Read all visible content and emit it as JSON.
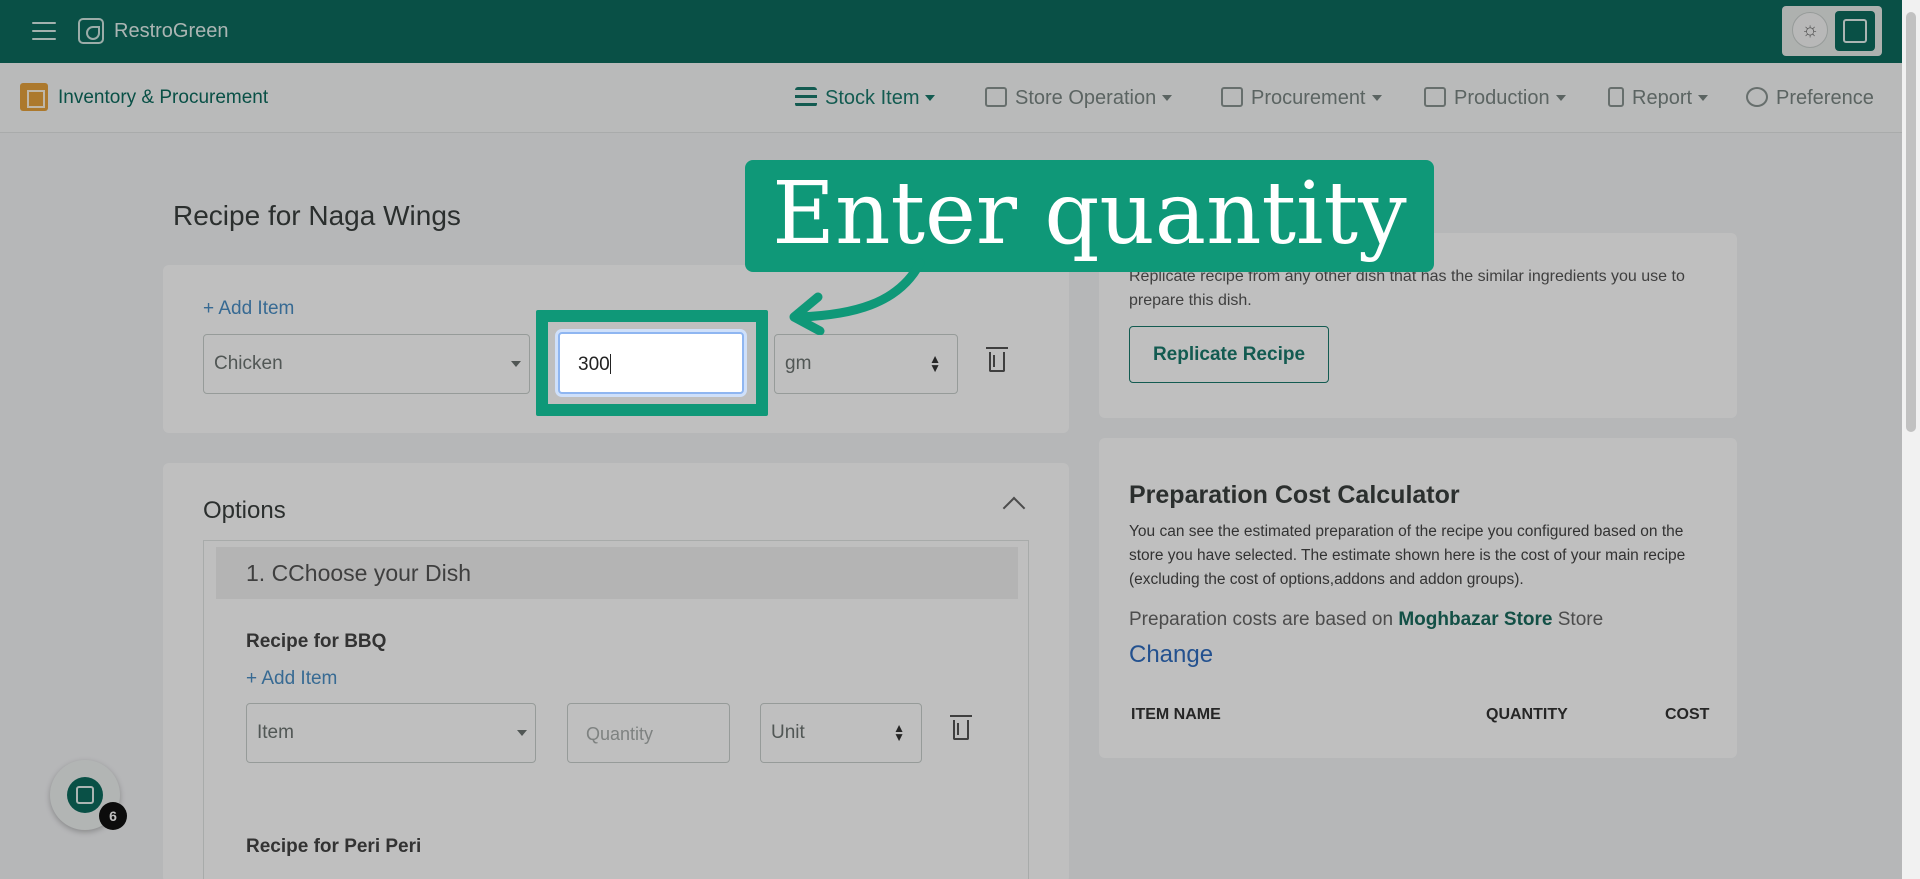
{
  "topbar": {
    "brand": "RestroGreen"
  },
  "module": {
    "title": "Inventory & Procurement"
  },
  "nav": {
    "items": [
      {
        "label": "Stock Item",
        "icon": "list-icon",
        "active": true
      },
      {
        "label": "Store Operation",
        "icon": "store-icon"
      },
      {
        "label": "Procurement",
        "icon": "server-icon"
      },
      {
        "label": "Production",
        "icon": "keyboard-icon"
      },
      {
        "label": "Report",
        "icon": "clipboard-icon"
      },
      {
        "label": "Preference",
        "icon": "gear-icon"
      }
    ]
  },
  "recipe": {
    "title": "Recipe for Naga Wings",
    "add_item": "+ Add Item",
    "ingredient": "Chicken",
    "quantity": "300",
    "unit": "gm"
  },
  "options": {
    "title": "Options",
    "group": "1. CChoose your Dish",
    "bbq": {
      "title": "Recipe for BBQ",
      "add_item": "+ Add Item",
      "item_placeholder": "Item",
      "quantity_placeholder": "Quantity",
      "unit_placeholder": "Unit"
    },
    "peri": {
      "title": "Recipe for Peri Peri"
    }
  },
  "replicate": {
    "text": "Replicate recipe from any other dish that has the similar ingredients you use to prepare this dish.",
    "button": "Replicate Recipe"
  },
  "calculator": {
    "title": "Preparation Cost Calculator",
    "description": "You can see the estimated preparation of the recipe you configured based on the store you have selected. The estimate shown here is the cost of your main recipe (excluding the cost of options,addons and addon groups).",
    "store_prefix": "Preparation costs are based on",
    "store_name": "Moghbazar Store",
    "store_suffix": "Store",
    "change": "Change",
    "columns": [
      "ITEM NAME",
      "QUANTITY",
      "COST"
    ]
  },
  "tutorial": {
    "callout": "Enter quantity"
  },
  "fab": {
    "badge": "6"
  },
  "colors": {
    "brand": "#0c6b5e",
    "callout": "#0f9878",
    "link": "#2f6dbf"
  }
}
